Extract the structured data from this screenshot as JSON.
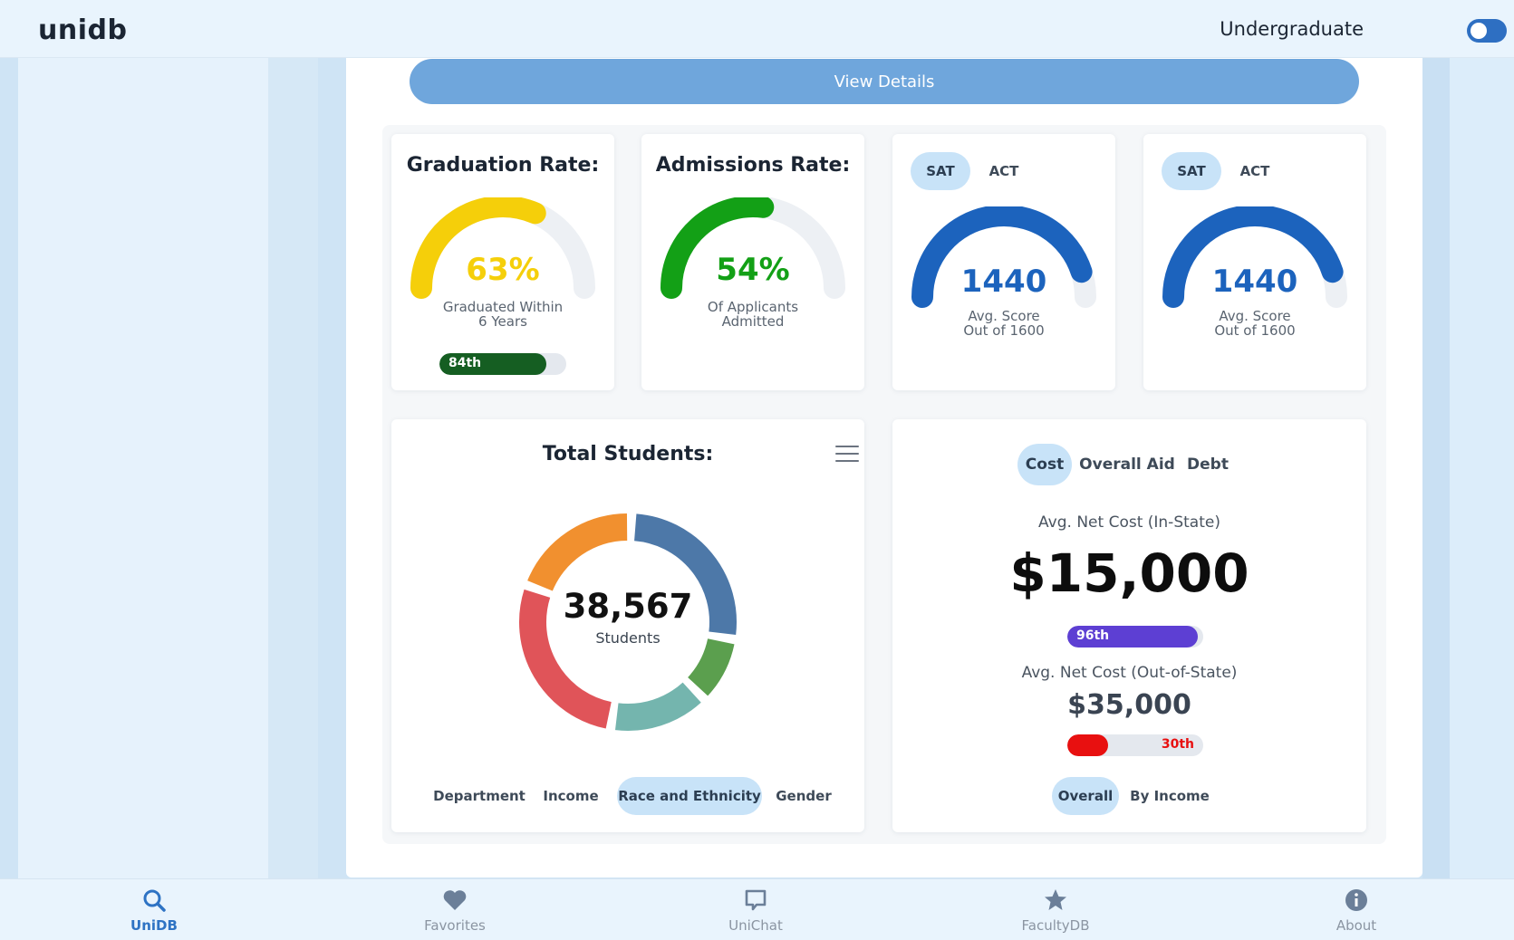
{
  "app": {
    "logo": "unidb",
    "mode_label": "Undergraduate",
    "mode_toggle_on": true
  },
  "view_details_label": "View Details",
  "graduation": {
    "title": "Graduation Rate:",
    "value": "63%",
    "fraction": 0.63,
    "caption_line1": "Graduated Within",
    "caption_line2": "6 Years",
    "percentile_label": "84th",
    "percentile_fraction": 0.84,
    "color": "#f5cf0a",
    "bar_color": "#155e22"
  },
  "admissions": {
    "title": "Admissions Rate:",
    "value": "54%",
    "fraction": 0.54,
    "caption_line1": "Of Applicants",
    "caption_line2": "Admitted",
    "color": "#13a016"
  },
  "test_scores": [
    {
      "tabs": [
        "SAT",
        "ACT"
      ],
      "active_tab": "SAT",
      "value": "1440",
      "fraction": 0.9,
      "caption_line1": "Avg. Score",
      "caption_line2": "Out of 1600",
      "color": "#1c63bd"
    },
    {
      "tabs": [
        "SAT",
        "ACT"
      ],
      "active_tab": "SAT",
      "value": "1440",
      "fraction": 0.9,
      "caption_line1": "Avg. Score",
      "caption_line2": "Out of 1600",
      "color": "#1c63bd"
    }
  ],
  "students": {
    "title": "Total Students:",
    "total": "38,567",
    "unit": "Students",
    "segments": [
      {
        "color": "#4d78a8",
        "fraction": 0.27
      },
      {
        "color": "#5b9f4e",
        "fraction": 0.1
      },
      {
        "color": "#74b5ae",
        "fraction": 0.15
      },
      {
        "color": "#e05459",
        "fraction": 0.28
      },
      {
        "color": "#f1902f",
        "fraction": 0.2
      }
    ],
    "tabs": [
      "Department",
      "Income",
      "Race and Ethnicity",
      "Gender"
    ],
    "active_tab": "Race and Ethnicity"
  },
  "cost": {
    "tabs": [
      "Cost",
      "Overall Aid",
      "Debt"
    ],
    "active_tab": "Cost",
    "in_state_label": "Avg. Net Cost (In-State)",
    "in_state_value": "$15,000",
    "in_state_percentile": "96th",
    "in_state_percentile_fraction": 0.96,
    "in_state_color": "#5d3fd3",
    "out_state_label": "Avg. Net Cost (Out-of-State)",
    "out_state_value": "$35,000",
    "out_state_percentile": "30th",
    "out_state_percentile_fraction": 0.3,
    "out_state_color": "#e81010",
    "sub_tabs": [
      "Overall",
      "By Income"
    ],
    "active_sub_tab": "Overall"
  },
  "nav": [
    {
      "label": "UniDB",
      "icon": "search-icon",
      "active": true
    },
    {
      "label": "Favorites",
      "icon": "heart-icon",
      "active": false
    },
    {
      "label": "UniChat",
      "icon": "chat-icon",
      "active": false
    },
    {
      "label": "FacultyDB",
      "icon": "star-icon",
      "active": false
    },
    {
      "label": "About",
      "icon": "info-icon",
      "active": false
    }
  ]
}
